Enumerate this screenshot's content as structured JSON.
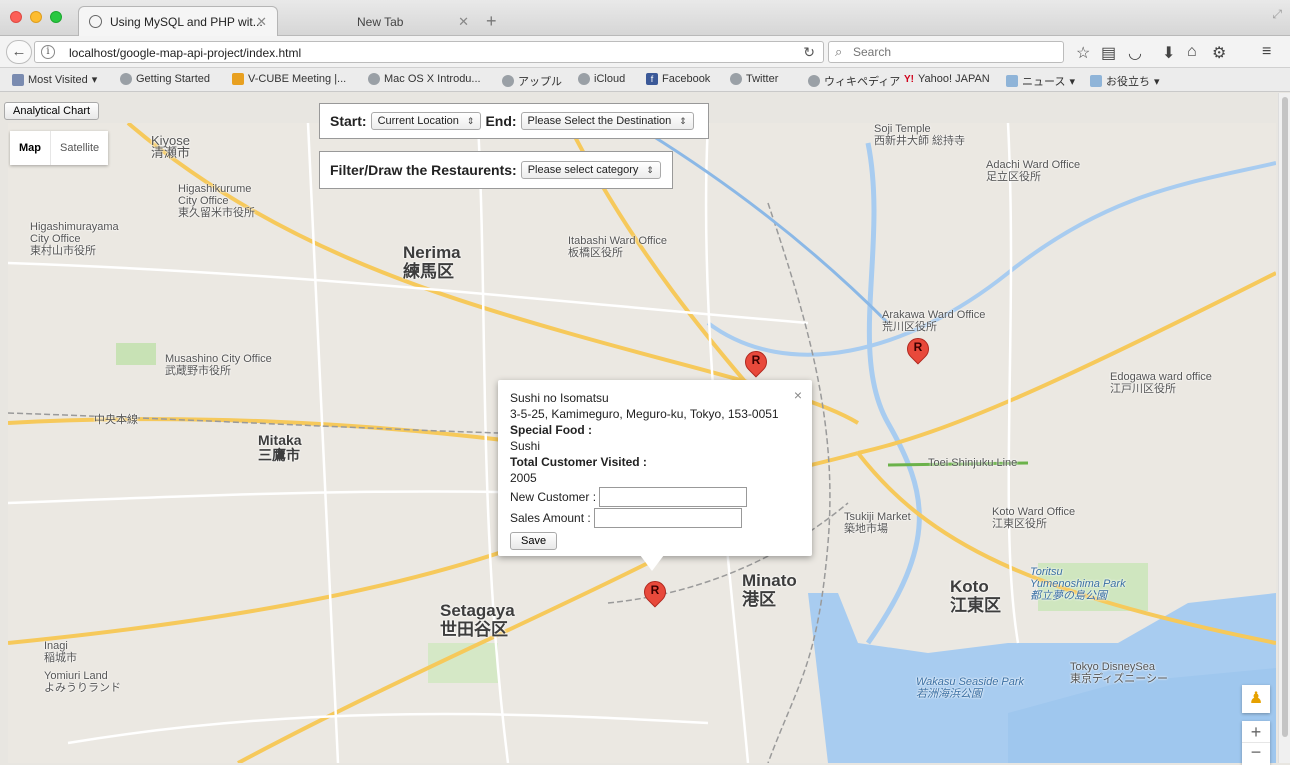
{
  "browser": {
    "tabs": [
      {
        "label": "Using MySQL and PHP wit...",
        "active": true
      },
      {
        "label": "New Tab",
        "active": false
      }
    ],
    "url": "localhost/google-map-api-project/index.html",
    "search_placeholder": "Search",
    "icons": [
      "back-arrow-icon",
      "info-icon",
      "reload-icon",
      "search-icon",
      "star-icon",
      "reading-list-icon",
      "pocket-icon",
      "download-icon",
      "home-icon",
      "extension-icon",
      "menu-icon"
    ],
    "bookmarks": [
      "Most Visited",
      "Getting Started",
      "V-CUBE Meeting |...",
      "Mac OS X Introdu...",
      "アップル",
      "iCloud",
      "Facebook",
      "Twitter",
      "ウィキペディア",
      "Yahoo! JAPAN",
      "ニュース",
      "お役立ち"
    ]
  },
  "page": {
    "analytical_chart_button": "Analytical Chart",
    "route": {
      "start_label": "Start:",
      "start_value": "Current Location",
      "end_label": "End:",
      "end_value": "Please Select the Destination"
    },
    "filter": {
      "label": "Filter/Draw the Restaurents:",
      "value": "Please select category"
    }
  },
  "map": {
    "type_control": {
      "map": "Map",
      "satellite": "Satellite"
    },
    "marker_label": "R",
    "labels": {
      "kiyose": "Kiyose\n清瀬市",
      "higashikurume": "Higashikurume\nCity Office\n東久留米市役所",
      "higashimurayama": "Higashimurayama\nCity Office\n東村山市役所",
      "nerima": "Nerima\n練馬区",
      "itabashi": "Itabashi Ward Office\n板橋区役所",
      "adachi": "Adachi Ward Office\n足立区役所",
      "arakawa": "Arakawa Ward Office\n荒川区役所",
      "edogawa": "Edogawa ward office\n江戸川区役所",
      "musashino": "Musashino City Office\n武蔵野市役所",
      "mitaka": "Mitaka\n三鷹市",
      "setagaya": "Setagaya\n世田谷区",
      "minato": "Minato\n港区",
      "koto": "Koto\n江東区",
      "koto_office": "Koto Ward Office\n江東区役所",
      "tsukiji": "Tsukiji Market\n築地市場",
      "inagi": "Inagi\n稲城市",
      "yomiuri": "Yomiuri Land\nよみうりランド",
      "disneysea": "Tokyo DisneySea\n東京ディズニーシー",
      "wakasu": "Wakasu Seaside Park\n若洲海浜公園",
      "yumenoshima": "Toritsu\nYumenoshima Park\n都立夢の島公園",
      "shinjuku_line": "Toei Shinjuku Line",
      "chuo_line": "中央本線",
      "sojitemple": "Soji Temple\n西新井大師 総持寺"
    },
    "info_window": {
      "name": "Sushi no Isomatsu",
      "address": "3-5-25, Kamimeguro, Meguro-ku, Tokyo, 153-0051",
      "special_food_label": "Special Food :",
      "special_food": "Sushi",
      "visited_label": "Total Customer Visited :",
      "visited": "2005",
      "new_customer_label": "New Customer :",
      "sales_label": "Sales Amount :",
      "save_label": "Save",
      "close_glyph": "×"
    }
  }
}
